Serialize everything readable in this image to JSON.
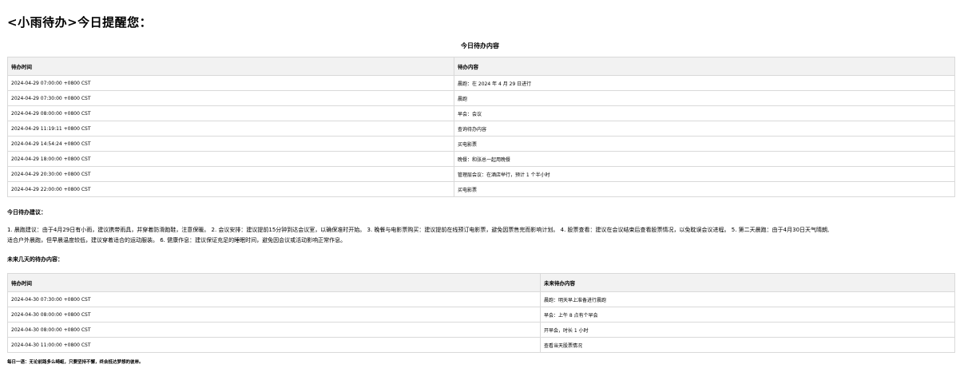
{
  "greeting": "<小雨待办>今日提醒您：",
  "today_section": {
    "title": "今日待办内容",
    "headers": [
      "待办时间",
      "待办内容"
    ],
    "rows": [
      {
        "time": "2024-04-29 07:00:00 +0800 CST",
        "content": "晨跑：在 2024 年 4 月 29 日进行"
      },
      {
        "time": "2024-04-29 07:30:00 +0800 CST",
        "content": "晨跑"
      },
      {
        "time": "2024-04-29 08:00:00 +0800 CST",
        "content": "早会：会议"
      },
      {
        "time": "2024-04-29 11:19:11 +0800 CST",
        "content": "查询待办内容"
      },
      {
        "time": "2024-04-29 14:54:24 +0800 CST",
        "content": "买电影票"
      },
      {
        "time": "2024-04-29 18:00:00 +0800 CST",
        "content": "晚餐：和张总一起用晚餐"
      },
      {
        "time": "2024-04-29 20:30:00 +0800 CST",
        "content": "管理层会议：在酒店举行，预计 1 个半小时"
      },
      {
        "time": "2024-04-29 22:00:00 +0800 CST",
        "content": "买电影票"
      }
    ]
  },
  "advice": {
    "title": "今日待办建议：",
    "line1": "1. 晨跑建议：由于4月29日有小雨，建议携带雨具，并穿着防滑跑鞋，注意保暖。 2. 会议安排：建议提前15分钟到达会议室，以确保准时开始。 3. 晚餐与电影票购买：建议提前在线预订电影票，避免因票售完而影响计划。 4. 股票查看：建议在会议结束后查看股票情况，以免耽误会议进程。 5. 第二天晨跑：由于4月30日天气晴朗,",
    "line2": "适合户外晨跑，但早晨温度较低，建议穿着适合的运动服装。 6. 健康作息：建议保证充足的睡眠时间，避免因会议或活动影响正常作息。"
  },
  "future_section": {
    "title": "未来几天的待办内容：",
    "headers": [
      "待办时间",
      "未来待办内容"
    ],
    "rows": [
      {
        "time": "2024-04-30 07:30:00 +0800 CST",
        "content": "晨跑：明天早上准备进行晨跑"
      },
      {
        "time": "2024-04-30 08:00:00 +0800 CST",
        "content": "早会：上午 8 点有个早会"
      },
      {
        "time": "2024-04-30 08:00:00 +0800 CST",
        "content": "开早会，时长 1 小时"
      },
      {
        "time": "2024-04-30 11:00:00 +0800 CST",
        "content": "查看当天股票情况"
      }
    ]
  },
  "footer": "每日一语：无论前路多么崎岖，只要坚持不懈，终会抵达梦想的彼岸。"
}
